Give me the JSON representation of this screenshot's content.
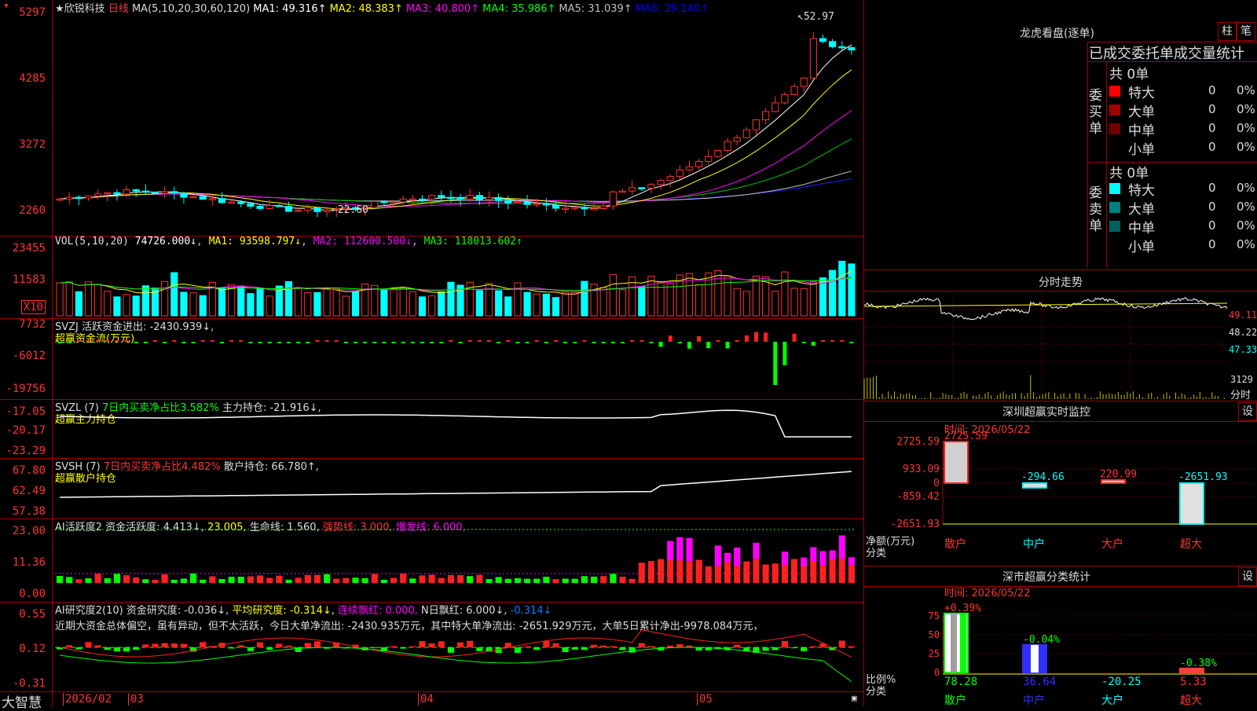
{
  "title": {
    "star": "★",
    "stock_name": "欣锐科技",
    "period": "日线",
    "ma_prefix": "MA(5,10,20,30,60,120)",
    "ma_values": [
      {
        "label": "MA1: 49.316↑",
        "color": "#ffffff"
      },
      {
        "label": "MA2: 48.383↑",
        "color": "#ffff00"
      },
      {
        "label": "MA3: 40.800↑",
        "color": "#ff00ff"
      },
      {
        "label": "MA4: 35.986↑",
        "color": "#00ff00"
      },
      {
        "label": "MA5: 31.039↑",
        "color": "#c0c0c0"
      },
      {
        "label": "MA6: 29.140↑",
        "color": "#0000ff"
      }
    ]
  },
  "price_axis": [
    "5297",
    "4285",
    "3272",
    "2260"
  ],
  "price_annotations": {
    "high": "52.97",
    "low": "22.60"
  },
  "vol": {
    "header": "VOL(5,10,20)",
    "value": "74726.000↓",
    "ma1": "MA1: 93598.797↓",
    "ma2": "MA2: 112600.500↓",
    "ma3": "MA3: 118013.602↑",
    "axis": [
      "23455",
      "11583"
    ],
    "unit": "X10"
  },
  "svzj": {
    "header": "SVZJ  活跃资金进出: -2430.939↓,",
    "sub": "超赢资金流(万元)",
    "axis": [
      "7732",
      "-6012",
      "-19756"
    ]
  },
  "svzl": {
    "header_a": "SVZL (7)",
    "header_b": "7日内买卖净占比3.582%",
    "header_c": "主力持仓: -21.916↓,",
    "sub": "超赢主力持仓",
    "axis": [
      "-17.05",
      "-20.17",
      "-23.29"
    ]
  },
  "svsh": {
    "header_a": "SVSH (7)",
    "header_b": "7日内买卖净占比4.482%",
    "header_c": "散户持仓: 66.780↑,",
    "sub": "超赢散户持仓",
    "axis": [
      "67.80",
      "62.49",
      "57.38"
    ]
  },
  "ai_active": {
    "a": "AI活跃度2",
    "b": "资金活跃度: 4.413↓,",
    "c": "23.005,",
    "d": "生命线: 1.560,",
    "e": "强势线: 3.000,",
    "f": "爆发线: 6.000,",
    "axis": [
      "23.00",
      "11.36",
      "0.00"
    ]
  },
  "ai_research": {
    "a": "AI研究度2(10)",
    "b": "资金研究度: -0.036↓,",
    "c": "平均研究度: -0.314↓,",
    "d": "连续飘红: 0.000,",
    "e": "N日飘红: 6.000↓,",
    "f": "-0.314↓",
    "summary": "近期大资金总体偏空，虽有异动，但不太活跃，今日大单净流出: -2430.935万元，其中特大单净流出: -2651.929万元，大单5日累计净出-9978.084万元，",
    "axis": [
      "0.55",
      "0.12",
      "-0.31"
    ]
  },
  "date_axis": {
    "brand": "大智慧",
    "labels": [
      "2026/02",
      "03",
      "04",
      "05"
    ]
  },
  "right_panel": {
    "lhb_title": "龙虎看盘(逐单)",
    "btn_zhu": "柱",
    "btn_bi": "笔",
    "tabs": "已成交委托单成交量统计",
    "buy": {
      "side_label": "委买单",
      "total": "共 0单",
      "rows": [
        {
          "name": "特大",
          "val": "0",
          "pct": "0%",
          "color": "#ff0000"
        },
        {
          "name": "大单",
          "val": "0",
          "pct": "0%",
          "color": "#a00000"
        },
        {
          "name": "中单",
          "val": "0",
          "pct": "0%",
          "color": "#700000"
        },
        {
          "name": "小单",
          "val": "0",
          "pct": "0%",
          "color": "#000000"
        }
      ]
    },
    "sell": {
      "side_label": "委卖单",
      "total": "共 0单",
      "rows": [
        {
          "name": "特大",
          "val": "0",
          "pct": "0%",
          "color": "#00ffff"
        },
        {
          "name": "大单",
          "val": "0",
          "pct": "0%",
          "color": "#008080"
        },
        {
          "name": "中单",
          "val": "0",
          "pct": "0%",
          "color": "#006060"
        },
        {
          "name": "小单",
          "val": "0",
          "pct": "0%",
          "color": "#000000"
        }
      ]
    },
    "intraday": {
      "title": "分时走势",
      "axis": [
        "49.11",
        "48.22",
        "47.33"
      ],
      "vol_label": "3129",
      "vol_unit": "分时"
    },
    "monitor": {
      "title": "深圳超赢实时监控",
      "btn": "设",
      "time": "时间: 2026/05/22",
      "axis": [
        "2725.59",
        "933.09",
        "0",
        "-859.42",
        "-2651.93"
      ],
      "bars": [
        {
          "name": "散户",
          "value": "2725.59"
        },
        {
          "name": "中户",
          "value": "-294.66"
        },
        {
          "name": "大户",
          "value": "220.99"
        },
        {
          "name": "超大",
          "value": "-2651.93"
        }
      ],
      "ylabel_a": "净额(万元)",
      "ylabel_b": "分类"
    },
    "classify": {
      "title": "深市超赢分类统计",
      "btn": "设",
      "time": "时间: 2026/05/22",
      "axis": [
        "75",
        "50",
        "25",
        "0"
      ],
      "bars": [
        {
          "name": "散户",
          "top": "+0.39%",
          "bottom": "78.28"
        },
        {
          "name": "中户",
          "top": "-0.04%",
          "bottom": "36.64"
        },
        {
          "name": "大户",
          "top": "",
          "bottom": "-20.25"
        },
        {
          "name": "超大",
          "top": "-0.38%",
          "bottom": "5.33"
        }
      ],
      "ylabel_a": "比例%",
      "ylabel_b": "分类"
    }
  },
  "colors": {
    "up": "#ff3232",
    "down": "#00ffff",
    "grid": "#a00000",
    "axis_text": "#ff3333"
  }
}
